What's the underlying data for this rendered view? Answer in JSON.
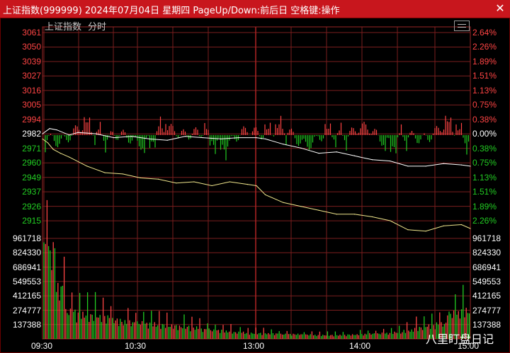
{
  "window": {
    "title": "上证指数(999999) 2024年07月04日 星期四 PageUp/Down:前后日 空格键:操作"
  },
  "chart_header": {
    "label": "上证指数",
    "period": "分时"
  },
  "watermark": "八里盯盘日记",
  "colors": {
    "background": "#000000",
    "grid": "#7a1e1e",
    "price_line": "#ffffff",
    "avg_line": "#f0e68c",
    "up": "#ff4444",
    "down": "#22cc22",
    "baseline_label": "#ffffff",
    "price_up_label": "#ff4444",
    "price_down_label": "#22cc22",
    "volume_label": "#ffffff",
    "time_label": "#ffffff"
  },
  "chart_data": {
    "type": "line",
    "title": "",
    "prev_close": 2982,
    "price_ticks": [
      "3061",
      "3050",
      "3039",
      "3027",
      "3016",
      "3005",
      "2994",
      "2982",
      "2971",
      "2960",
      "2949",
      "2937",
      "2926",
      "2915"
    ],
    "pct_ticks": [
      "2.64%",
      "2.26%",
      "1.89%",
      "1.51%",
      "1.13%",
      "0.75%",
      "0.38%",
      "0.00%",
      "0.38%",
      "0.75%",
      "1.13%",
      "1.51%",
      "1.89%",
      "2.26%"
    ],
    "volume_ticks": [
      "961718",
      "824330",
      "686941",
      "549553",
      "412165",
      "274777",
      "137388"
    ],
    "time_ticks": [
      "09:30",
      "10:30",
      "13:00",
      "14:00",
      "15:00"
    ],
    "price_range": [
      2904,
      3061
    ],
    "volume_max": 961718,
    "series": [
      {
        "x": [
          "09:30",
          "09:34",
          "09:38",
          "09:45",
          "09:50",
          "10:00",
          "10:10",
          "10:20",
          "10:30",
          "10:40",
          "10:50",
          "11:00",
          "11:10",
          "11:20",
          "11:30",
          "13:05",
          "13:15",
          "13:25",
          "13:35",
          "13:45",
          "13:55",
          "14:05",
          "14:15",
          "14:25",
          "14:35",
          "14:45",
          "14:55",
          "15:00"
        ],
        "values": [
          2983,
          2987,
          2986,
          2982,
          2984,
          2983,
          2980,
          2981,
          2979,
          2978,
          2981,
          2980,
          2979,
          2980,
          2980,
          2979,
          2975,
          2972,
          2968,
          2969,
          2966,
          2963,
          2962,
          2958,
          2958,
          2960,
          2959,
          2958
        ]
      },
      {
        "x": [
          "09:30",
          "09:33",
          "09:36",
          "09:40",
          "09:45",
          "09:55",
          "10:05",
          "10:15",
          "10:25",
          "10:35",
          "10:45",
          "10:55",
          "11:05",
          "11:15",
          "11:25",
          "11:30",
          "13:05",
          "13:15",
          "13:25",
          "13:35",
          "13:45",
          "13:55",
          "14:05",
          "14:15",
          "14:25",
          "14:35",
          "14:45",
          "14:55",
          "15:00"
        ],
        "values": [
          2979,
          2976,
          2971,
          2968,
          2965,
          2958,
          2953,
          2952,
          2949,
          2948,
          2945,
          2946,
          2943,
          2946,
          2944,
          2943,
          2936,
          2930,
          2927,
          2924,
          2921,
          2921,
          2919,
          2916,
          2909,
          2908,
          2912,
          2913,
          2910
        ]
      }
    ],
    "volume_estimate": [
      930000,
      540000,
      290000,
      260000,
      250000,
      230000,
      200000,
      180000,
      170000,
      160000,
      150000,
      140000,
      130000,
      120000,
      100000,
      90000,
      80000,
      70000,
      60000,
      60000,
      55000,
      50000,
      50000,
      45000,
      40000,
      40000,
      40000,
      45000,
      50000,
      55000,
      60000,
      70000,
      90000,
      120000,
      140000,
      160000,
      270000,
      300000
    ]
  }
}
